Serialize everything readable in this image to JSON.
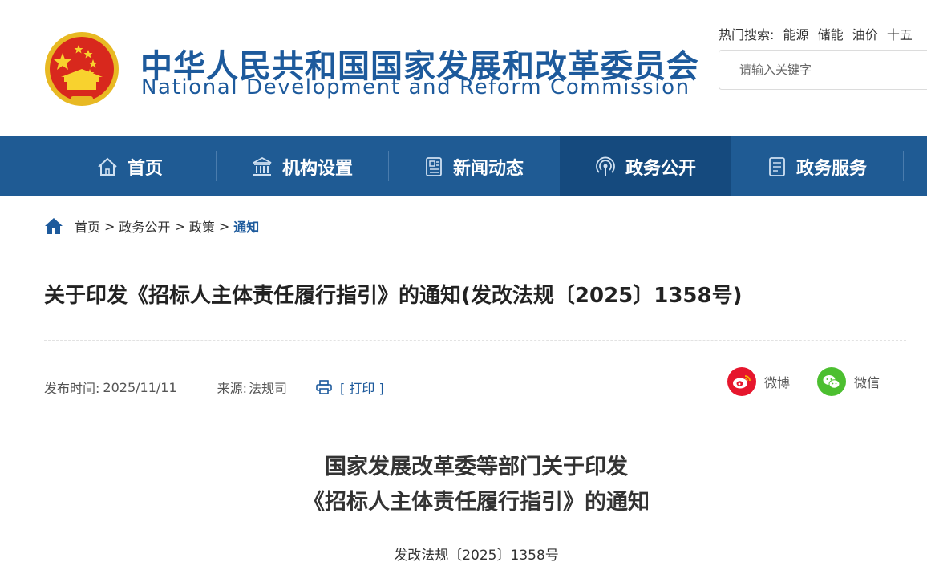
{
  "header": {
    "org_name_cn": "中华人民共和国国家发展和改革委员会",
    "org_name_en": "National Development and Reform Commission",
    "hot_search_label": "热门搜索:",
    "hot_keywords": [
      "能源",
      "储能",
      "油价",
      "十五"
    ],
    "search_placeholder": "请输入关键字"
  },
  "nav": {
    "items": [
      {
        "label": "首页",
        "icon": "home-outline-icon"
      },
      {
        "label": "机构设置",
        "icon": "institution-icon"
      },
      {
        "label": "新闻动态",
        "icon": "newspaper-icon"
      },
      {
        "label": "政务公开",
        "icon": "broadcast-icon",
        "active": true
      },
      {
        "label": "政务服务",
        "icon": "document-icon"
      }
    ]
  },
  "breadcrumb": {
    "items": [
      "首页",
      "政务公开",
      "政策"
    ],
    "current": "通知",
    "separator": ">"
  },
  "article": {
    "title": "关于印发《招标人主体责任履行指引》的通知(发改法规〔2025〕1358号)",
    "publish_label": "发布时间:",
    "publish_date": "2025/11/11",
    "source_label": "来源:",
    "source": "法规司",
    "print_label": "[ 打印 ]",
    "share_weibo": "微博",
    "share_wechat": "微信",
    "doc_heading_line1": "国家发展改革委等部门关于印发",
    "doc_heading_line2": "《招标人主体责任履行指引》的通知",
    "doc_number": "发改法规〔2025〕1358号"
  },
  "colors": {
    "brand_blue": "#1d5a9c",
    "nav_bg": "#1f5b94",
    "nav_active": "#154a7e",
    "weibo_red": "#e6162d",
    "wechat_green": "#4cbf30"
  }
}
